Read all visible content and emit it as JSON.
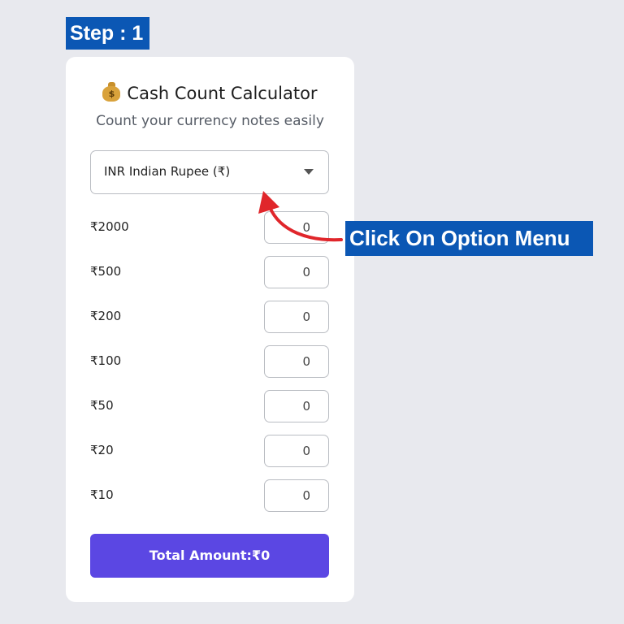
{
  "annotation": {
    "step_label": "Step : 1",
    "callout_text": "Click On Option Menu",
    "accent_color": "#0b57b4",
    "arrow_color": "#e0262b"
  },
  "app": {
    "title": "Cash Count Calculator",
    "title_icon": "money-bag-icon",
    "subtitle": "Count your currency notes easily",
    "currency_select": {
      "selected": "INR Indian Rupee (₹)"
    },
    "denominations": [
      {
        "label": "₹2000",
        "count": "0"
      },
      {
        "label": "₹500",
        "count": "0"
      },
      {
        "label": "₹200",
        "count": "0"
      },
      {
        "label": "₹100",
        "count": "0"
      },
      {
        "label": "₹50",
        "count": "0"
      },
      {
        "label": "₹20",
        "count": "0"
      },
      {
        "label": "₹10",
        "count": "0"
      }
    ],
    "total_label": "Total Amount:₹0",
    "button_color": "#5b47e3"
  }
}
